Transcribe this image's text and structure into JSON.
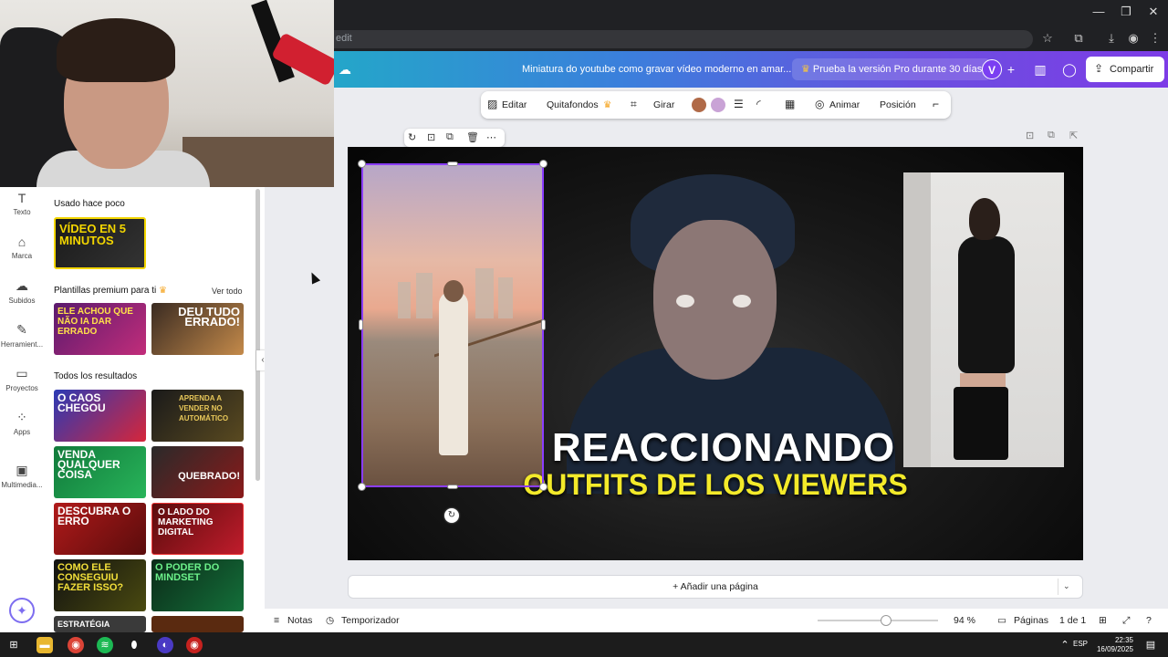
{
  "browser": {
    "url_fragment": "edit"
  },
  "header": {
    "title": "Miniatura do youtube como gravar vídeo moderno en amar...",
    "pro_label": "Prueba la versión Pro durante 30 días",
    "avatar": "V",
    "share_label": "Compartir"
  },
  "rail": [
    {
      "icon": "T",
      "label": "Texto"
    },
    {
      "icon": "⌂",
      "label": "Marca"
    },
    {
      "icon": "☁",
      "label": "Subidos"
    },
    {
      "icon": "✎",
      "label": "Herramient..."
    },
    {
      "icon": "▭",
      "label": "Proyectos"
    },
    {
      "icon": "⁘",
      "label": "Apps"
    },
    {
      "icon": "▣",
      "label": "Multimedia..."
    }
  ],
  "panel": {
    "recent_title": "Usado hace poco",
    "premium_title": "Plantillas premium para ti",
    "see_all": "Ver todo",
    "all_title": "Todos los resultados",
    "thumbs": {
      "recent": "VÍDEO EN 5 MINUTOS",
      "p1": "ELE ACHOU QUE NÃO IA DAR ERRADO",
      "p2": "DEU TUDO ERRADO!",
      "r1": "O CAOS CHEGOU",
      "r2": "APRENDA A VENDER NO AUTOMÁTICO",
      "r3": "VENDA QUALQUER COISA",
      "r4": "QUEBRADO!",
      "r5": "DESCUBRA O ERRO",
      "r6": "O LADO DO MARKETING DIGITAL",
      "r7": "COMO ELE CONSEGUIU FAZER ISSO?",
      "r8": "O PODER DO MINDSET",
      "r9": "ESTRATÉGIA"
    }
  },
  "toolbar": {
    "edit": "Editar",
    "bg_remover": "Quitafondos",
    "rotate": "Girar",
    "animate": "Animar",
    "position": "Posición",
    "swatch1": "#b06a48",
    "swatch2": "#c9a3d6"
  },
  "canvas": {
    "title_line1": "REACCIONANDO",
    "title_line2": "OUTFITS DE LOS VIEWERS",
    "add_page": "+ Añadir una página"
  },
  "footer": {
    "notes": "Notas",
    "timer": "Temporizador",
    "zoom": "94 %",
    "pages_label": "Páginas",
    "page_count": "1 de 1"
  },
  "taskbar": {
    "lang": "ESP",
    "time": "22:35",
    "date": "16/09/2025"
  },
  "colors": {
    "accent": "#8b3dff",
    "title_yellow": "#f3ea2a"
  }
}
